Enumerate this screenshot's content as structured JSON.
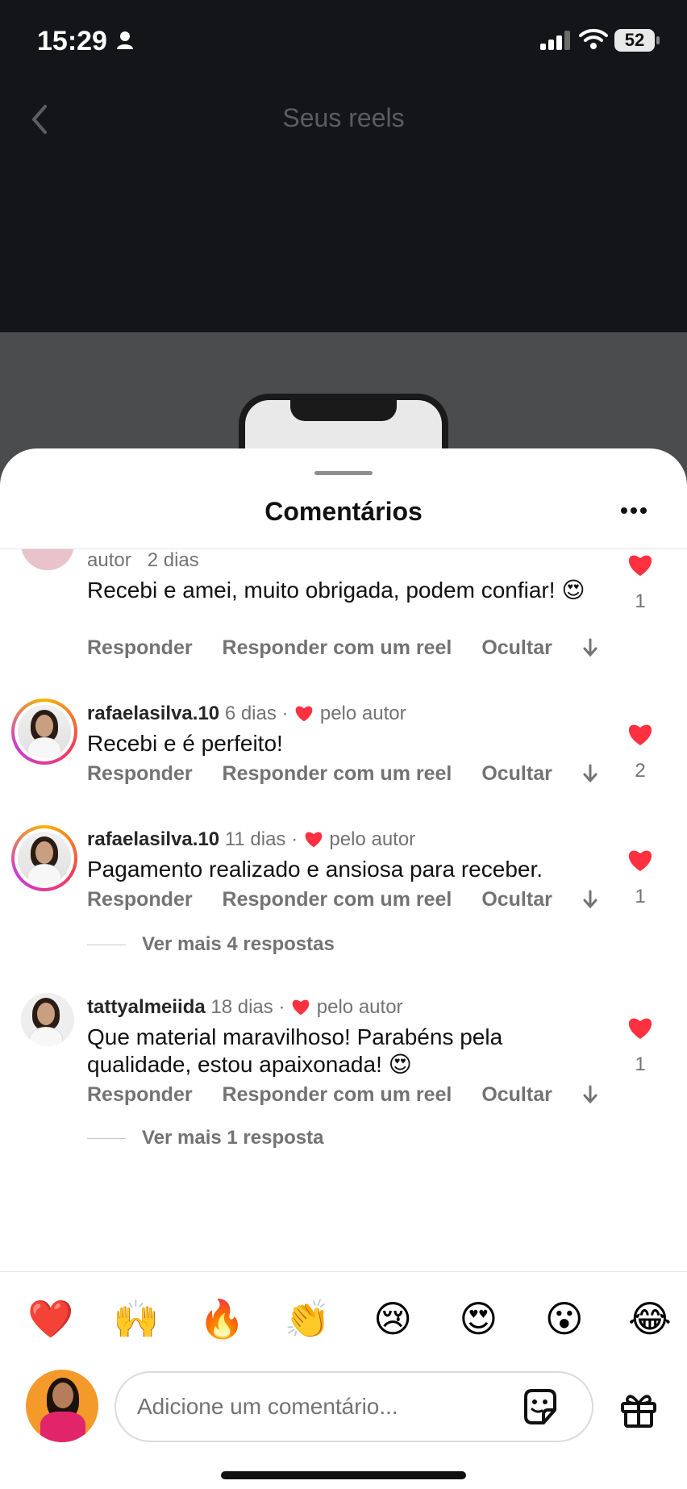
{
  "status_bar": {
    "time": "15:29",
    "battery": "52"
  },
  "header": {
    "title": "Seus reels"
  },
  "sheet": {
    "title": "Comentários"
  },
  "comments": [
    {
      "user": "",
      "meta_prefix": "autor",
      "time": "2 dias",
      "text": "Recebi e amei, muito obrigada, podem confiar! 😍",
      "actions": [
        "Responder",
        "Responder com um reel",
        "Ocultar"
      ],
      "likes": "1"
    },
    {
      "user": "rafaelasilva.10",
      "time": "6 dias",
      "liked_by_author": "pelo autor",
      "text": "Recebi e é perfeito!",
      "actions": [
        "Responder",
        "Responder com um reel",
        "Ocultar"
      ],
      "likes": "2"
    },
    {
      "user": "rafaelasilva.10",
      "time": "11 dias",
      "liked_by_author": "pelo autor",
      "text": "Pagamento realizado e ansiosa para receber.",
      "actions": [
        "Responder",
        "Responder com um reel",
        "Ocultar"
      ],
      "likes": "1",
      "view_more": "Ver mais 4 respostas"
    },
    {
      "user": "tattyalmeiida",
      "time": "18 dias",
      "liked_by_author": "pelo autor",
      "text": "Que material maravilhoso! Parabéns pela qualidade, estou apaixonada! 😍",
      "actions": [
        "Responder",
        "Responder com um reel",
        "Ocultar"
      ],
      "likes": "1",
      "view_more": "Ver mais 1 resposta"
    }
  ],
  "emoji_bar": [
    "❤️",
    "🙌",
    "🔥",
    "👏",
    "😢",
    "😍",
    "😮",
    "😂"
  ],
  "composer": {
    "placeholder": "Adicione um comentário..."
  },
  "colors": {
    "like_red": "#ff3040",
    "muted_text": "#737373"
  }
}
